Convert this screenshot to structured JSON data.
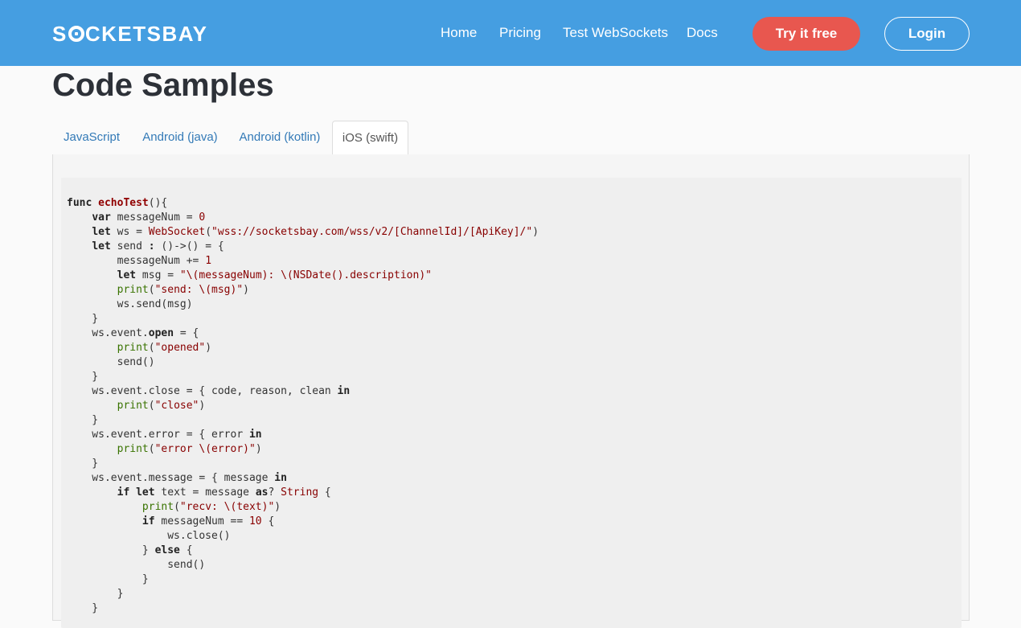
{
  "brand": {
    "logo_text_before": "S",
    "logo_text_after": "CKETSBAY"
  },
  "nav": {
    "links": [
      "Home",
      "Pricing",
      "Test WebSockets",
      "Docs"
    ],
    "try_label": "Try it free",
    "login_label": "Login"
  },
  "page": {
    "title": "Code Samples"
  },
  "tabs": {
    "items": [
      "JavaScript",
      "Android (java)",
      "Android (kotlin)",
      "iOS (swift)"
    ],
    "active": "iOS (swift)"
  },
  "colors": {
    "navbar": "#459ee1",
    "try_button": "#e8574f",
    "link": "#337ab7"
  },
  "code": {
    "language": "swift",
    "lines": [
      [
        [
          "func ",
          "kw"
        ],
        [
          "echoTest",
          "fn"
        ],
        [
          "(){",
          "plain"
        ]
      ],
      [
        [
          "    ",
          "plain"
        ],
        [
          "var",
          "kw"
        ],
        [
          " messageNum = ",
          "plain"
        ],
        [
          "0",
          "num"
        ]
      ],
      [
        [
          "    ",
          "plain"
        ],
        [
          "let",
          "kw"
        ],
        [
          " ws = ",
          "plain"
        ],
        [
          "WebSocket",
          "type"
        ],
        [
          "(",
          "plain"
        ],
        [
          "\"wss://socketsbay.com/wss/v2/[ChannelId]/[ApiKey]/\"",
          "str"
        ],
        [
          ")",
          "plain"
        ]
      ],
      [
        [
          "    ",
          "plain"
        ],
        [
          "let",
          "kw"
        ],
        [
          " send ",
          "plain"
        ],
        [
          ":",
          "kw"
        ],
        [
          " ()->() = {",
          "plain"
        ]
      ],
      [
        [
          "        messageNum += ",
          "plain"
        ],
        [
          "1",
          "num"
        ]
      ],
      [
        [
          "        ",
          "plain"
        ],
        [
          "let",
          "kw"
        ],
        [
          " msg = ",
          "plain"
        ],
        [
          "\"\\(messageNum): \\(NSDate().description)\"",
          "str"
        ]
      ],
      [
        [
          "        ",
          "plain"
        ],
        [
          "print",
          "bi"
        ],
        [
          "(",
          "plain"
        ],
        [
          "\"send: \\(msg)\"",
          "str"
        ],
        [
          ")",
          "plain"
        ]
      ],
      [
        [
          "        ws.send(msg)",
          "plain"
        ]
      ],
      [
        [
          "    }",
          "plain"
        ]
      ],
      [
        [
          "    ws.event.",
          "plain"
        ],
        [
          "open",
          "kw"
        ],
        [
          " = {",
          "plain"
        ]
      ],
      [
        [
          "        ",
          "plain"
        ],
        [
          "print",
          "bi"
        ],
        [
          "(",
          "plain"
        ],
        [
          "\"opened\"",
          "str"
        ],
        [
          ")",
          "plain"
        ]
      ],
      [
        [
          "        send()",
          "plain"
        ]
      ],
      [
        [
          "    }",
          "plain"
        ]
      ],
      [
        [
          "    ws.event.close = { code, reason, clean ",
          "plain"
        ],
        [
          "in",
          "kw"
        ]
      ],
      [
        [
          "        ",
          "plain"
        ],
        [
          "print",
          "bi"
        ],
        [
          "(",
          "plain"
        ],
        [
          "\"close\"",
          "str"
        ],
        [
          ")",
          "plain"
        ]
      ],
      [
        [
          "    }",
          "plain"
        ]
      ],
      [
        [
          "    ws.event.error = { error ",
          "plain"
        ],
        [
          "in",
          "kw"
        ]
      ],
      [
        [
          "        ",
          "plain"
        ],
        [
          "print",
          "bi"
        ],
        [
          "(",
          "plain"
        ],
        [
          "\"error \\(error)\"",
          "str"
        ],
        [
          ")",
          "plain"
        ]
      ],
      [
        [
          "    }",
          "plain"
        ]
      ],
      [
        [
          "    ws.event.message = { message ",
          "plain"
        ],
        [
          "in",
          "kw"
        ]
      ],
      [
        [
          "        ",
          "plain"
        ],
        [
          "if",
          "kw"
        ],
        [
          " ",
          "plain"
        ],
        [
          "let",
          "kw"
        ],
        [
          " text = message ",
          "plain"
        ],
        [
          "as",
          "kw"
        ],
        [
          "? ",
          "plain"
        ],
        [
          "String",
          "type"
        ],
        [
          " {",
          "plain"
        ]
      ],
      [
        [
          "            ",
          "plain"
        ],
        [
          "print",
          "bi"
        ],
        [
          "(",
          "plain"
        ],
        [
          "\"recv: \\(text)\"",
          "str"
        ],
        [
          ")",
          "plain"
        ]
      ],
      [
        [
          "            ",
          "plain"
        ],
        [
          "if",
          "kw"
        ],
        [
          " messageNum == ",
          "plain"
        ],
        [
          "10",
          "num"
        ],
        [
          " {",
          "plain"
        ]
      ],
      [
        [
          "                ws.close()",
          "plain"
        ]
      ],
      [
        [
          "            } ",
          "plain"
        ],
        [
          "else",
          "kw"
        ],
        [
          " {",
          "plain"
        ]
      ],
      [
        [
          "                send()",
          "plain"
        ]
      ],
      [
        [
          "            }",
          "plain"
        ]
      ],
      [
        [
          "        }",
          "plain"
        ]
      ],
      [
        [
          "    }",
          "plain"
        ]
      ]
    ]
  }
}
